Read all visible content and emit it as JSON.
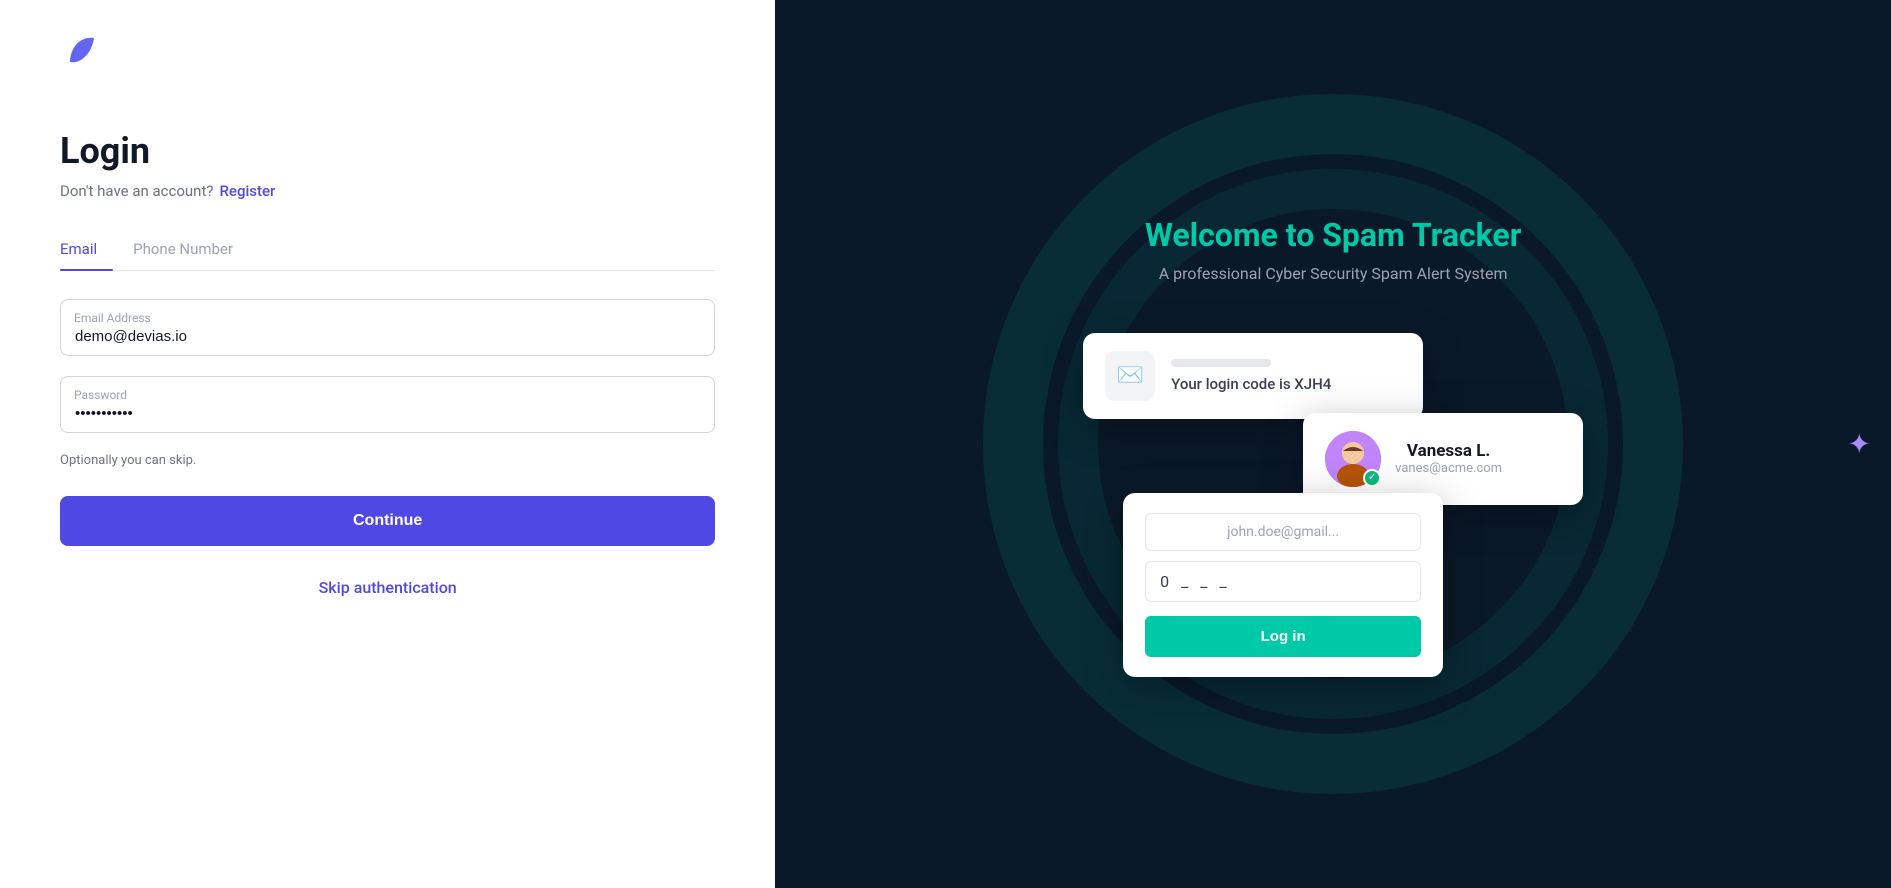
{
  "app": {
    "logo_alt": "Spam Tracker Logo"
  },
  "left": {
    "title": "Login",
    "no_account_label": "Don't have an account?",
    "register_label": "Register",
    "tabs": [
      {
        "id": "email",
        "label": "Email",
        "active": true
      },
      {
        "id": "phone",
        "label": "Phone Number",
        "active": false
      }
    ],
    "email_label": "Email Address",
    "email_value": "demo@devias.io",
    "password_label": "Password",
    "password_value": "••••••••••••",
    "optional_text": "Optionally you can skip.",
    "continue_button": "Continue",
    "skip_label": "Skip authentication"
  },
  "right": {
    "welcome_text": "Welcome to ",
    "brand_name": "Spam Tracker",
    "subtitle": "A professional Cyber Security Spam Alert System",
    "notification_card": {
      "code_text": "Your login code is XJH4"
    },
    "profile_card": {
      "name": "Vanessa L.",
      "email": "vanes@acme.com"
    },
    "login_card": {
      "email_placeholder": "john.doe@gmail...",
      "otp_display": "0 _ _ _",
      "login_button": "Log in"
    }
  }
}
